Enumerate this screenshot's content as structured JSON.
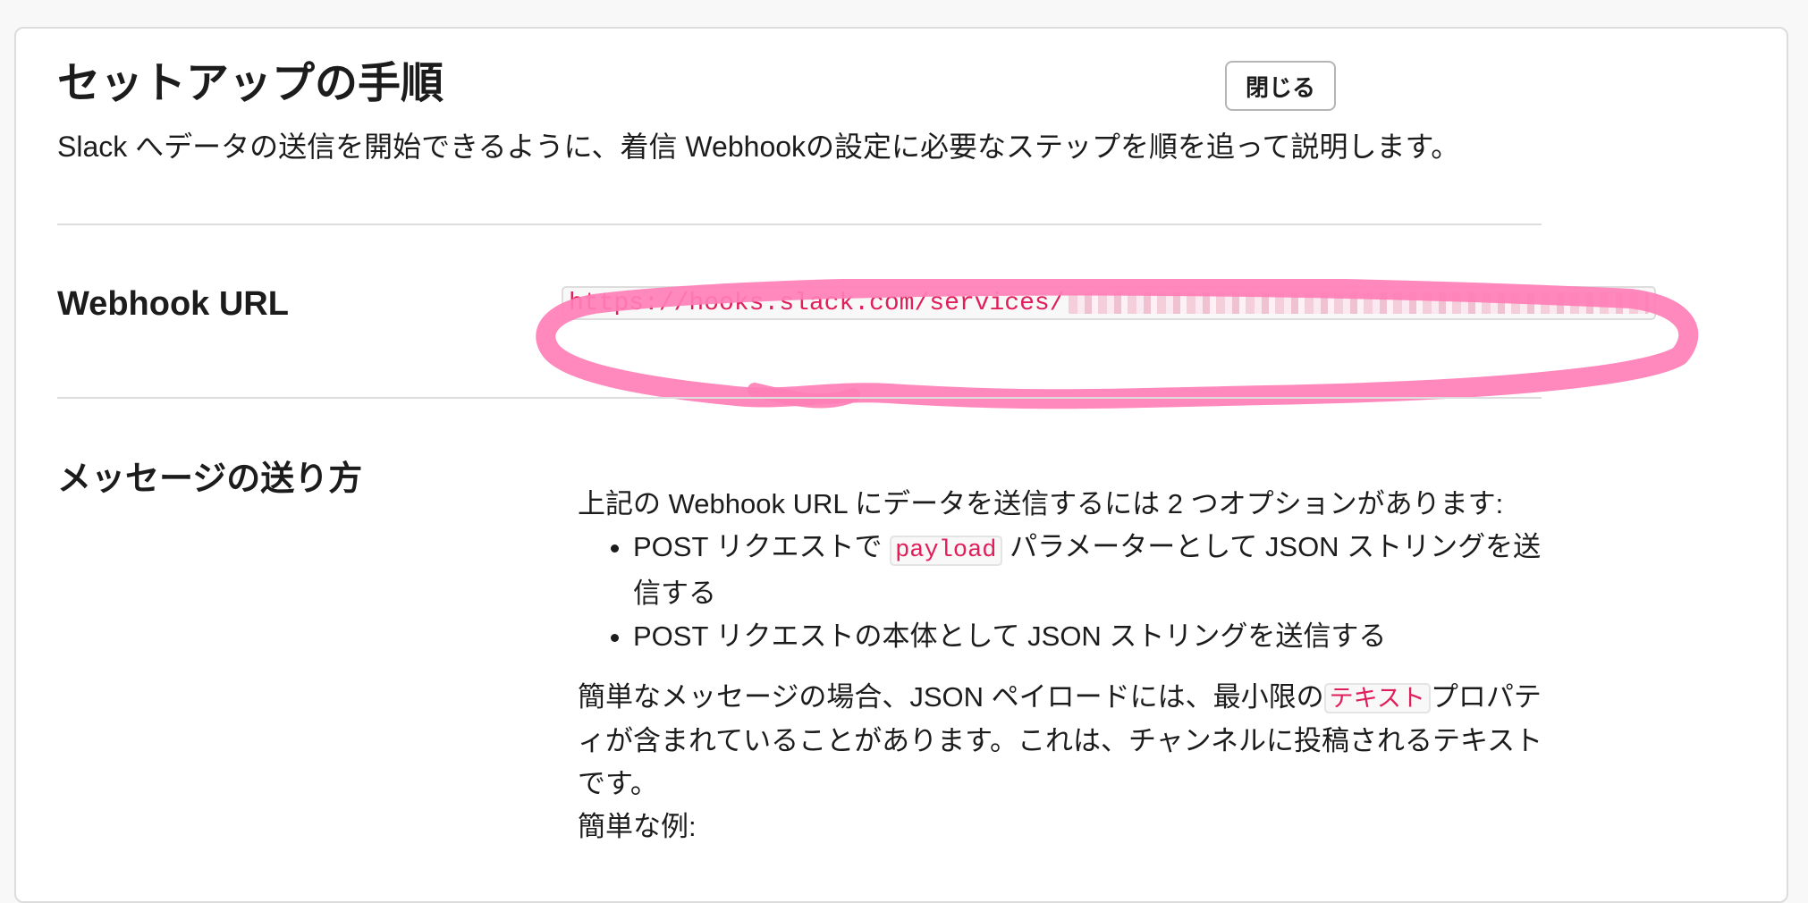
{
  "header": {
    "title": "セットアップの手順",
    "subtitle": "Slack へデータの送信を開始できるように、着信 Webhookの設定に必要なステップを順を追って説明します。",
    "close_label": "閉じる"
  },
  "webhook": {
    "label": "Webhook URL",
    "url_visible": "https://hooks.slack.com/services/"
  },
  "message": {
    "label": "メッセージの送り方",
    "intro": "上記の Webhook URL にデータを送信するには 2 つオプションがあります:",
    "option1_before": "POST リクエストで",
    "option1_code": "payload",
    "option1_after": "パラメーターとして JSON ストリングを送信する",
    "option2": "POST リクエストの本体として JSON ストリングを送信する",
    "simple_before": "簡単なメッセージの場合、JSON ペイロードには、最小限の",
    "simple_code": "テキスト",
    "simple_after": "プロパティが含まれていることがあります。これは、チャンネルに投稿されるテキストです。",
    "example_label": "簡単な例:"
  },
  "colors": {
    "code_text": "#e01e5a",
    "highlight": "#ff7eb6",
    "divider": "#dddddd"
  }
}
